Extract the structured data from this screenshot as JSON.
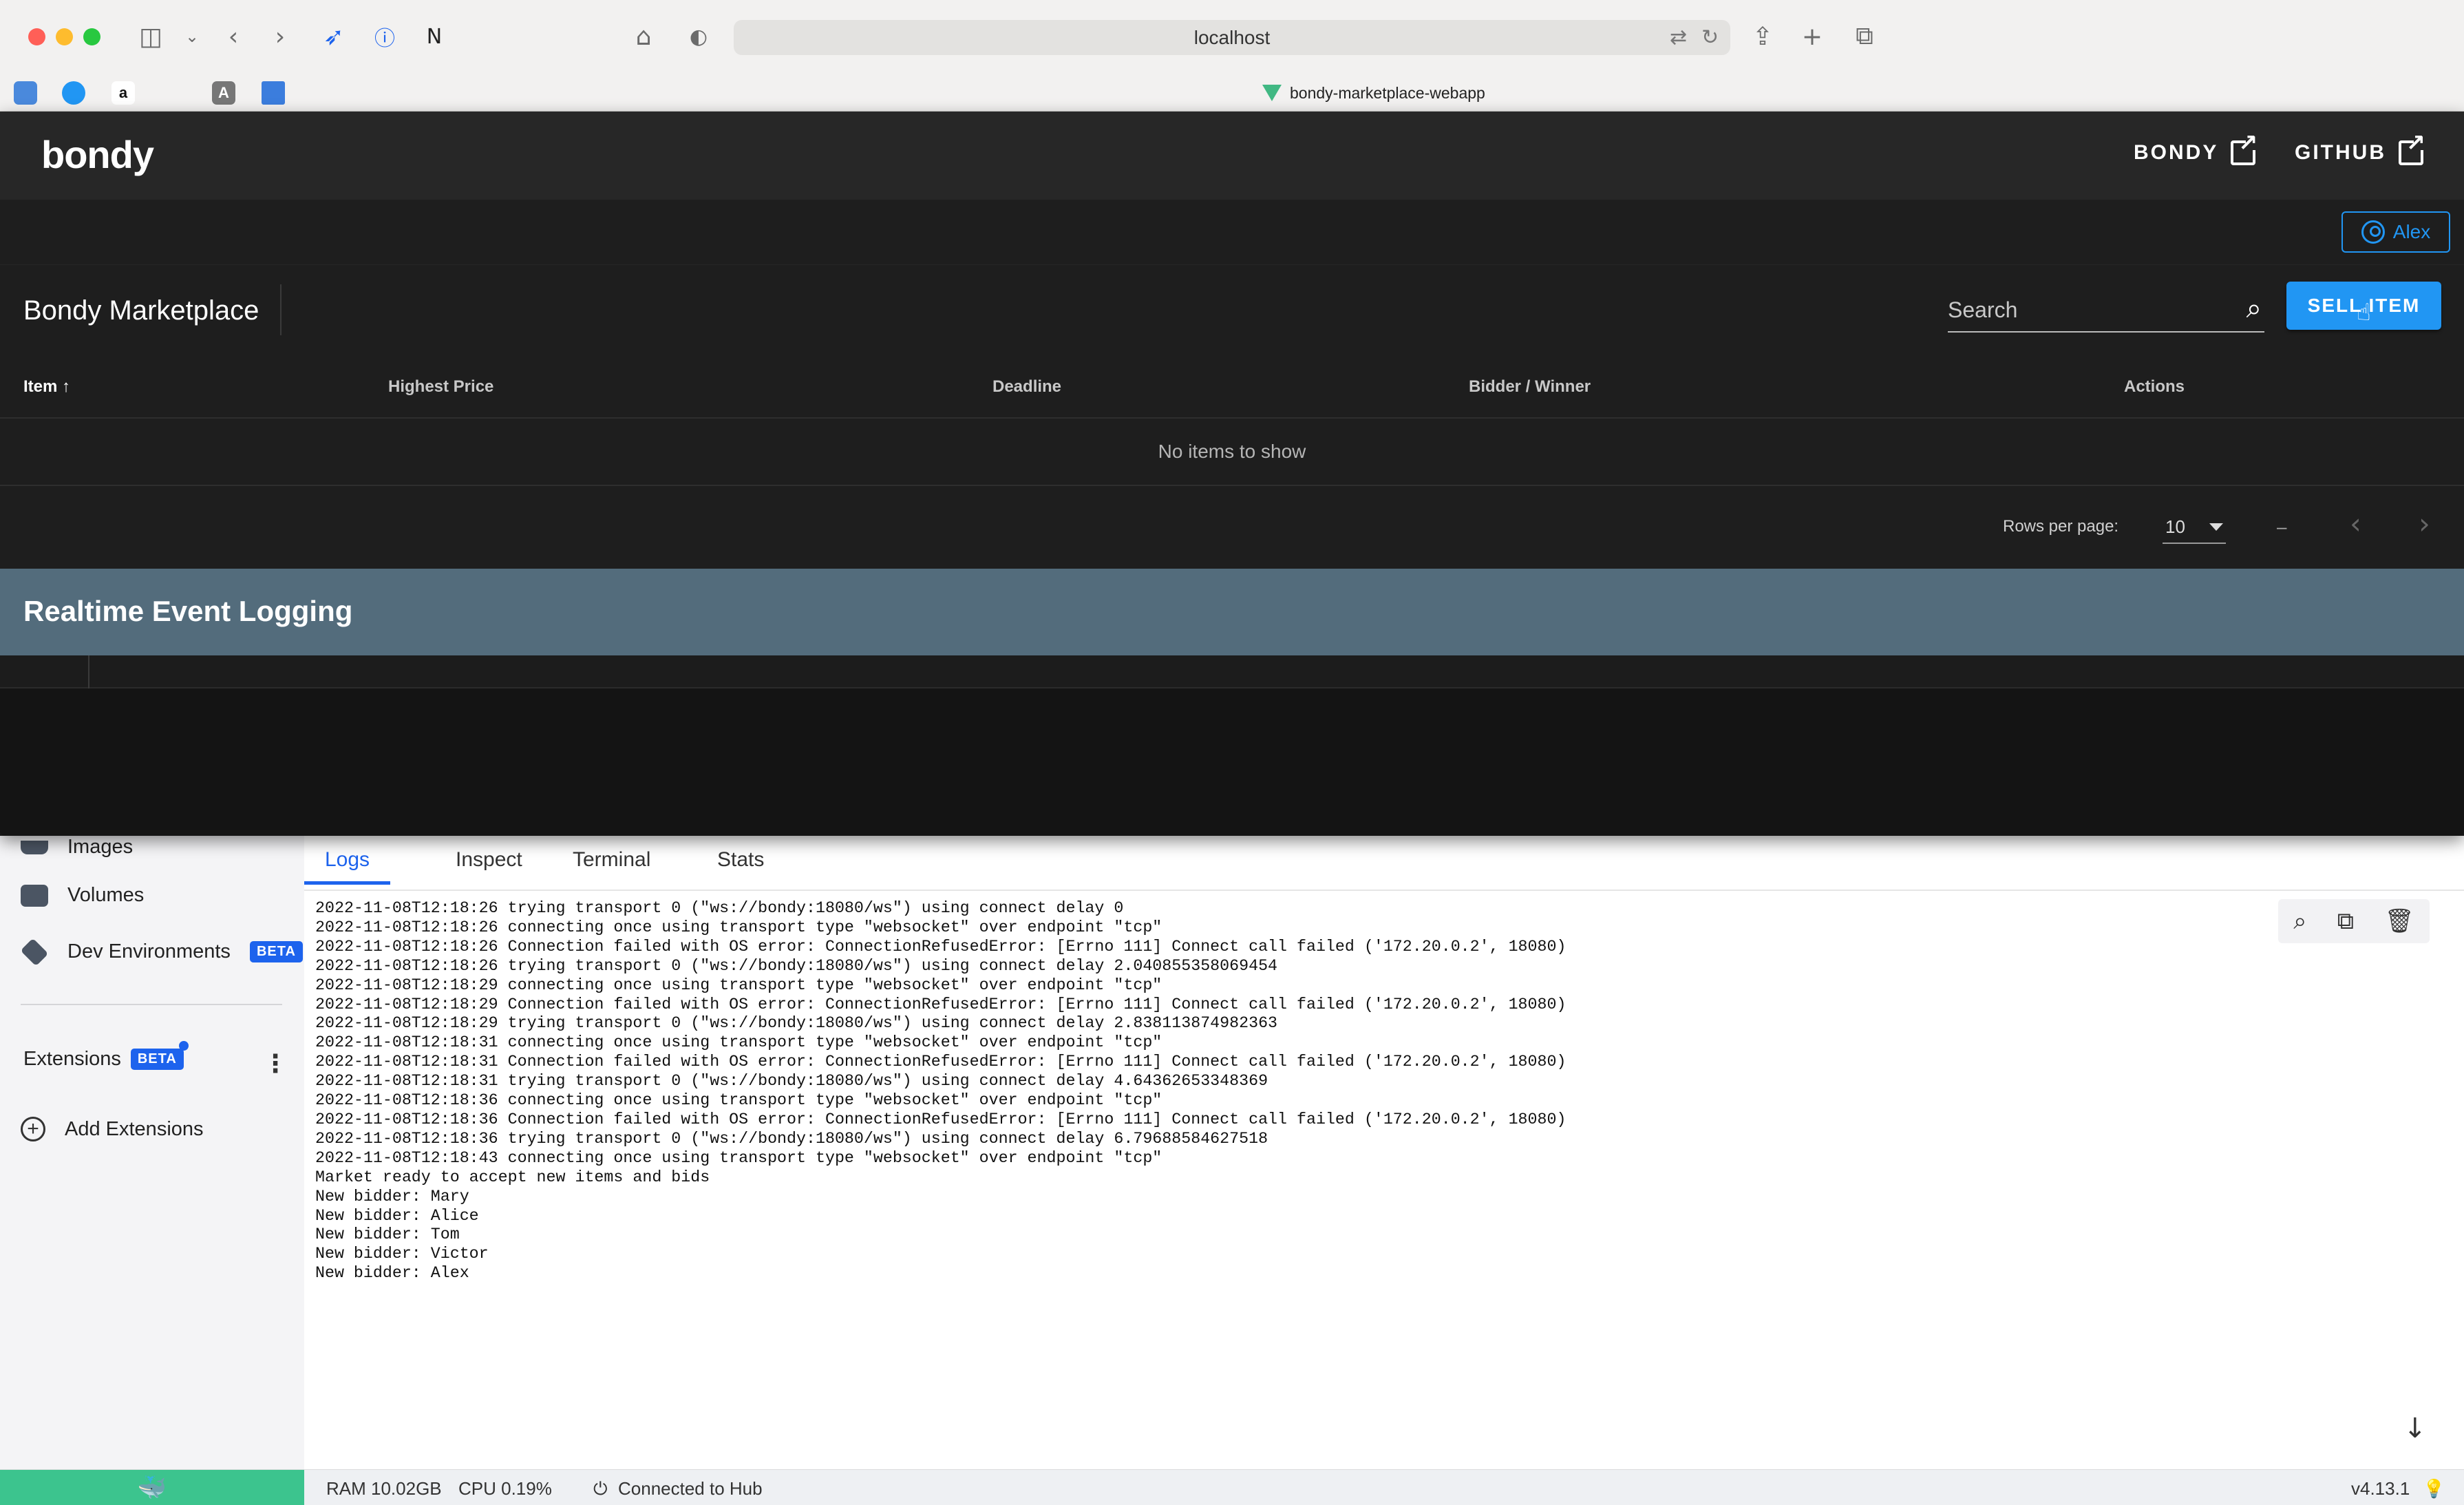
{
  "browser": {
    "address": "localhost",
    "tab_title": "bondy-marketplace-webapp",
    "favorites": [
      "",
      "",
      "a",
      "",
      "A",
      ""
    ]
  },
  "app": {
    "logo": "bondy",
    "links": {
      "bondy": "BONDY",
      "github": "GITHUB"
    },
    "user": "Alex",
    "toolbar": {
      "title": "Bondy Marketplace",
      "search_placeholder": "Search",
      "sell_label": "SELL ITEM"
    },
    "table": {
      "headers": [
        "Item",
        "Highest Price",
        "Deadline",
        "Bidder / Winner",
        "Actions"
      ],
      "sort_indicator": "↑",
      "empty": "No items to show",
      "rows_per_page_label": "Rows per page:",
      "rows_per_page": "10",
      "range": "–"
    },
    "log_panel": {
      "title": "Realtime Event Logging"
    }
  },
  "docker": {
    "sidebar": {
      "images": "Images",
      "volumes": "Volumes",
      "dev_env": "Dev Environments",
      "beta": "BETA",
      "extensions": "Extensions",
      "add_extensions": "Add Extensions"
    },
    "tabs": [
      "Logs",
      "Inspect",
      "Terminal",
      "Stats"
    ],
    "logs": [
      "2022-11-08T12:18:26 trying transport 0 (\"ws://bondy:18080/ws\") using connect delay 0",
      "2022-11-08T12:18:26 connecting once using transport type \"websocket\" over endpoint \"tcp\"",
      "2022-11-08T12:18:26 Connection failed with OS error: ConnectionRefusedError: [Errno 111] Connect call failed ('172.20.0.2', 18080)",
      "2022-11-08T12:18:26 trying transport 0 (\"ws://bondy:18080/ws\") using connect delay 2.040855358069454",
      "2022-11-08T12:18:29 connecting once using transport type \"websocket\" over endpoint \"tcp\"",
      "2022-11-08T12:18:29 Connection failed with OS error: ConnectionRefusedError: [Errno 111] Connect call failed ('172.20.0.2', 18080)",
      "2022-11-08T12:18:29 trying transport 0 (\"ws://bondy:18080/ws\") using connect delay 2.838113874982363",
      "2022-11-08T12:18:31 connecting once using transport type \"websocket\" over endpoint \"tcp\"",
      "2022-11-08T12:18:31 Connection failed with OS error: ConnectionRefusedError: [Errno 111] Connect call failed ('172.20.0.2', 18080)",
      "2022-11-08T12:18:31 trying transport 0 (\"ws://bondy:18080/ws\") using connect delay 4.64362653348369",
      "2022-11-08T12:18:36 connecting once using transport type \"websocket\" over endpoint \"tcp\"",
      "2022-11-08T12:18:36 Connection failed with OS error: ConnectionRefusedError: [Errno 111] Connect call failed ('172.20.0.2', 18080)",
      "2022-11-08T12:18:36 trying transport 0 (\"ws://bondy:18080/ws\") using connect delay 6.79688584627518",
      "2022-11-08T12:18:43 connecting once using transport type \"websocket\" over endpoint \"tcp\"",
      "Market ready to accept new items and bids",
      "New bidder: Mary",
      "New bidder: Alice",
      "New bidder: Tom",
      "New bidder: Victor",
      "New bidder: Alex"
    ],
    "status": {
      "ram": "RAM 10.02GB",
      "cpu": "CPU 0.19%",
      "hub": "Connected to Hub",
      "version": "v4.13.1"
    }
  }
}
